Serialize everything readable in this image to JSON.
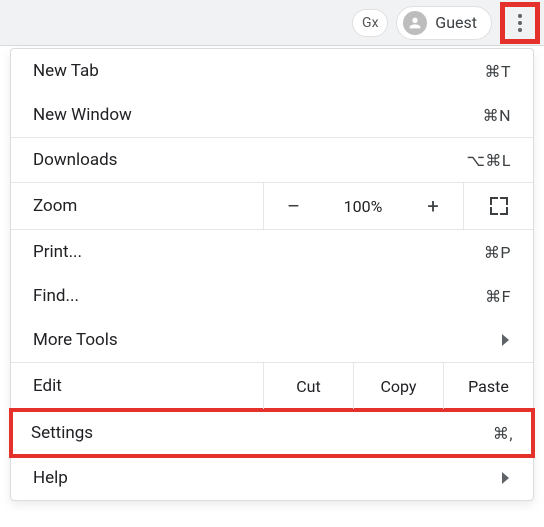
{
  "toolbar": {
    "translate_icon_label": "Gx",
    "guest_label": "Guest"
  },
  "menu": {
    "new_tab": {
      "label": "New Tab",
      "shortcut": "⌘T"
    },
    "new_window": {
      "label": "New Window",
      "shortcut": "⌘N"
    },
    "downloads": {
      "label": "Downloads",
      "shortcut": "⌥⌘L"
    },
    "zoom": {
      "label": "Zoom",
      "minus": "–",
      "percent": "100%",
      "plus": "+"
    },
    "print": {
      "label": "Print...",
      "shortcut": "⌘P"
    },
    "find": {
      "label": "Find...",
      "shortcut": "⌘F"
    },
    "more_tools": {
      "label": "More Tools"
    },
    "edit": {
      "label": "Edit",
      "cut": "Cut",
      "copy": "Copy",
      "paste": "Paste"
    },
    "settings": {
      "label": "Settings",
      "shortcut": "⌘,"
    },
    "help": {
      "label": "Help"
    }
  }
}
